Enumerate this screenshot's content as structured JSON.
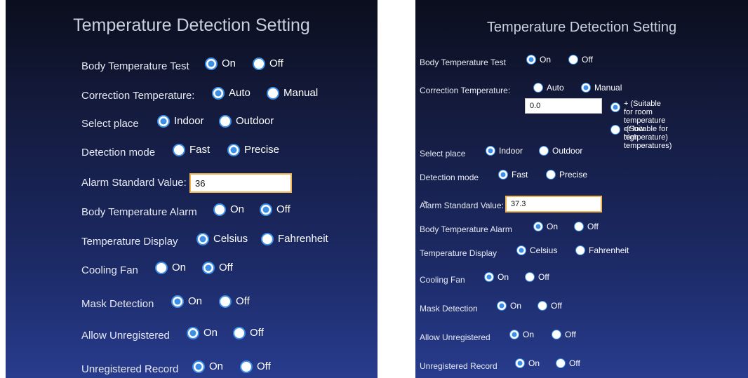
{
  "left": {
    "title": "Temperature Detection Setting",
    "rows": [
      {
        "label": "Body Temperature Test",
        "options": [
          "On",
          "Off"
        ],
        "selected": 0
      },
      {
        "label": "Correction Temperature:",
        "options": [
          "Auto",
          "Manual"
        ],
        "selected": 0
      },
      {
        "label": "Select place",
        "options": [
          "Indoor",
          "Outdoor"
        ],
        "selected": 0
      },
      {
        "label": "Detection mode",
        "options": [
          "Fast",
          "Precise"
        ],
        "selected": 1
      },
      {
        "label": "Alarm Standard Value:",
        "value": "36"
      },
      {
        "label": "Body Temperature Alarm",
        "options": [
          "On",
          "Off"
        ],
        "selected": 1
      },
      {
        "label": "Temperature Display",
        "options": [
          "Celsius",
          "Fahrenheit"
        ],
        "selected": 0
      },
      {
        "label": "Cooling Fan",
        "options": [
          "On",
          "Off"
        ],
        "selected": 1
      },
      {
        "label": "Mask Detection",
        "options": [
          "On",
          "Off"
        ],
        "selected": 0
      },
      {
        "label": "Allow Unregistered",
        "options": [
          "On",
          "Off"
        ],
        "selected": 0
      },
      {
        "label": "Unregistered Record",
        "options": [
          "On",
          "Off"
        ],
        "selected": 0
      }
    ]
  },
  "right": {
    "title": "Temperature Detection Setting",
    "rows": [
      {
        "label": "Body Temperature Test",
        "options": [
          "On",
          "Off"
        ],
        "selected": 0
      },
      {
        "label": "Correction Temperature:",
        "options": [
          "Auto",
          "Manual"
        ],
        "selected": 1
      },
      {
        "label": "Select place",
        "options": [
          "Indoor",
          "Outdoor"
        ],
        "selected": 0
      },
      {
        "label": "Detection mode",
        "options": [
          "Fast",
          "Precise"
        ],
        "selected": 0
      },
      {
        "label": "Alarm Standard Value:",
        "value": "37.3"
      },
      {
        "label": "Body Temperature Alarm",
        "options": [
          "On",
          "Off"
        ],
        "selected": 0
      },
      {
        "label": "Temperature Display",
        "options": [
          "Celsius",
          "Fahrenheit"
        ],
        "selected": 0
      },
      {
        "label": "Cooling Fan",
        "options": [
          "On",
          "Off"
        ],
        "selected": 0
      },
      {
        "label": "Mask Detection",
        "options": [
          "On",
          "Off"
        ],
        "selected": 0
      },
      {
        "label": "Allow Unregistered",
        "options": [
          "On",
          "Off"
        ],
        "selected": 0
      },
      {
        "label": "Unregistered Record",
        "options": [
          "On",
          "Off"
        ],
        "selected": 0
      }
    ],
    "correction": {
      "value": "0.0",
      "plus_label_line1": "+ (Suitable for room temperature",
      "plus_label_line2": "or low temperature)",
      "minus_label": "-(Suitable for high temperatures)",
      "selected": 0
    }
  },
  "colors": {
    "accent": "#3d8fe6",
    "field_border": "#f3b550",
    "title": "#c9cfdc"
  }
}
